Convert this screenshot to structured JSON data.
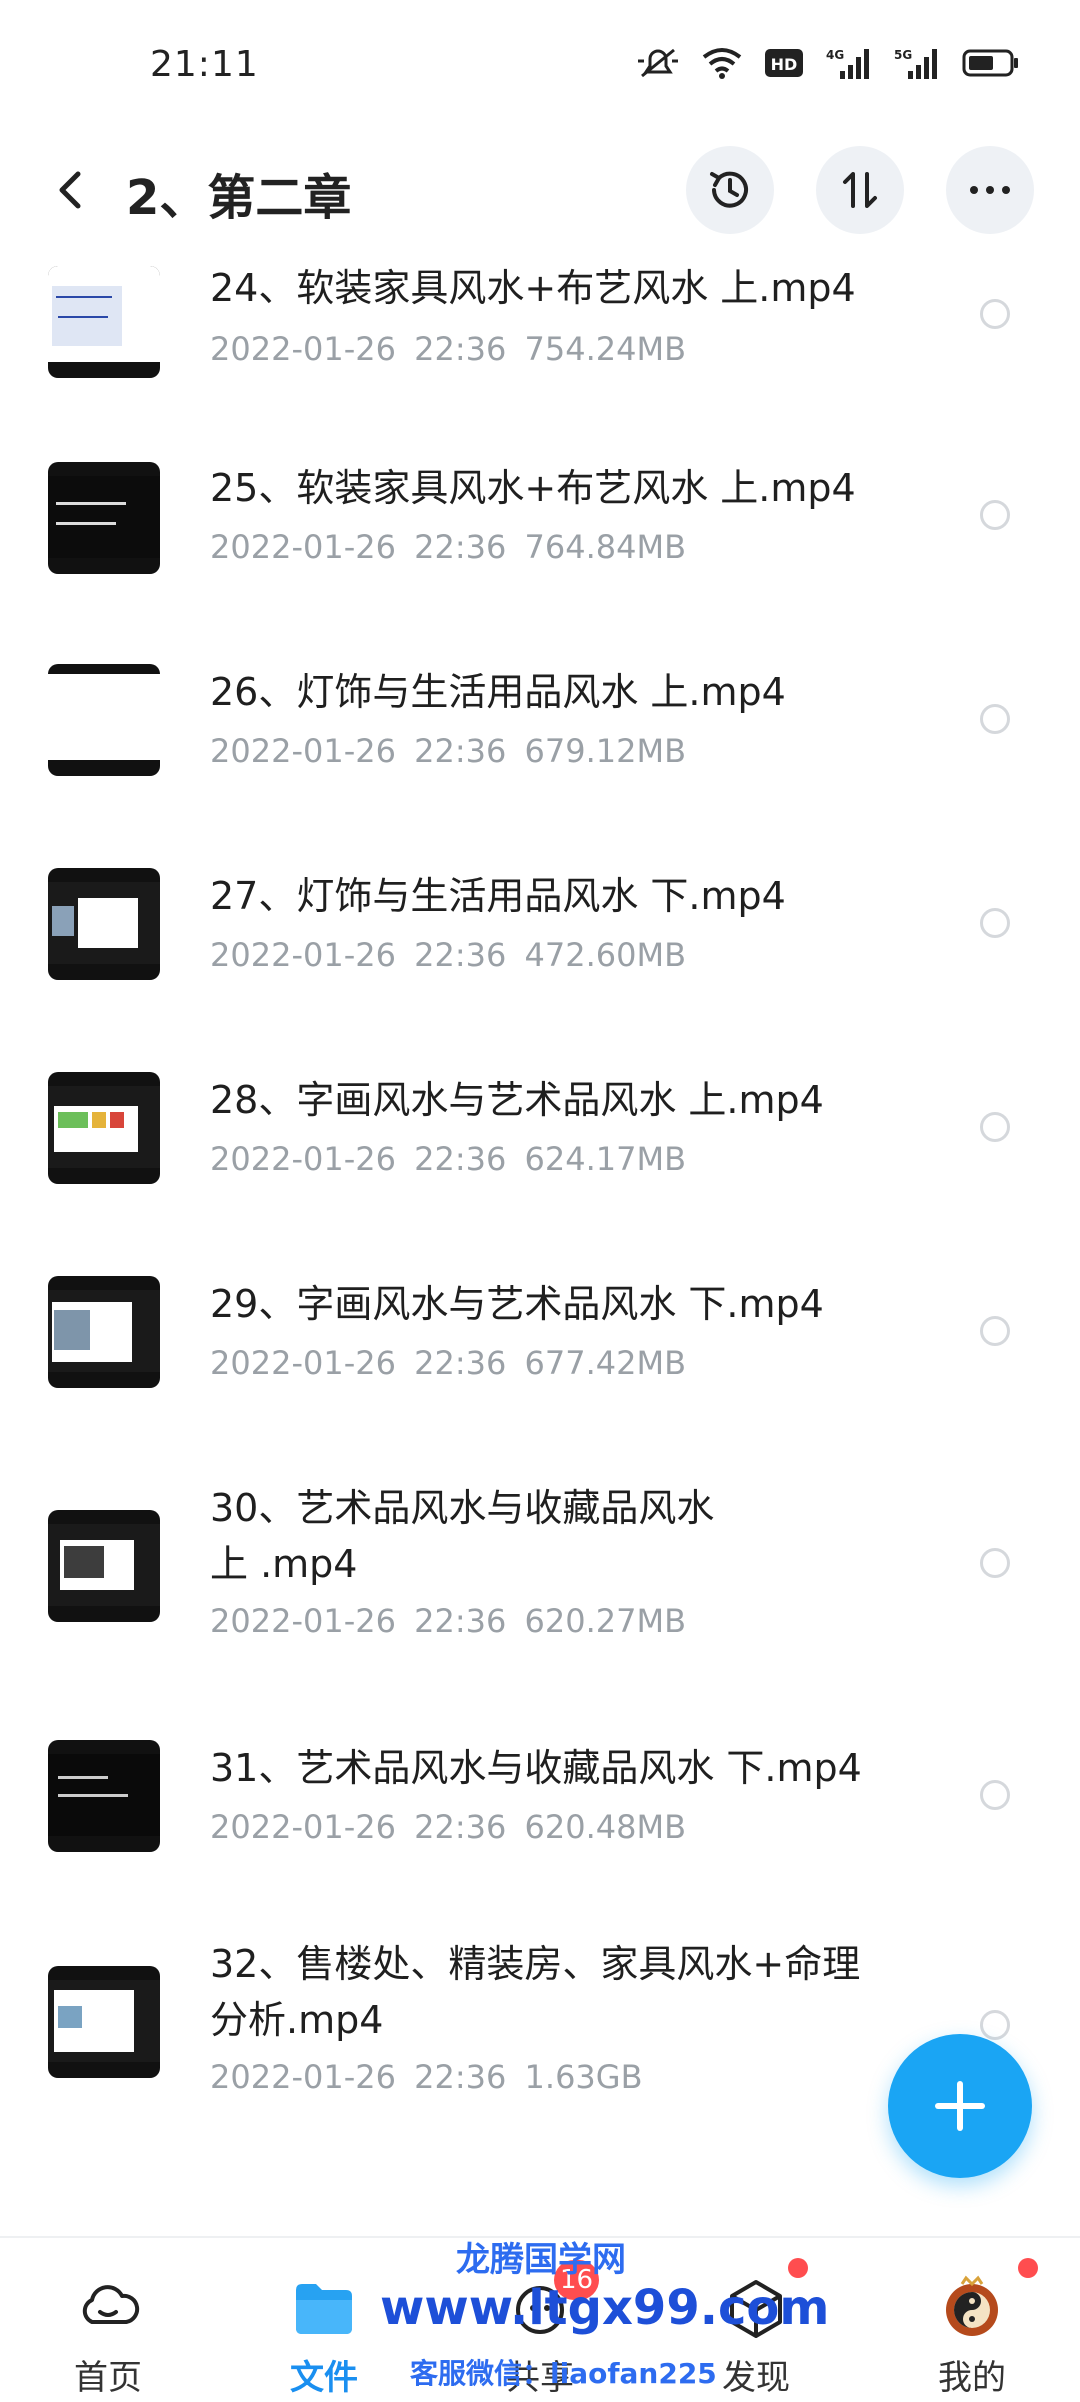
{
  "status_bar": {
    "time": "21:11"
  },
  "header": {
    "title": "2、第二章"
  },
  "files": [
    {
      "name": "24、软装家具风水+布艺风水 上.mp4",
      "date": "2022-01-26  22:36",
      "size": "754.24MB"
    },
    {
      "name": "25、软装家具风水+布艺风水 上.mp4",
      "date": "2022-01-26  22:36",
      "size": "764.84MB"
    },
    {
      "name": "26、灯饰与生活用品风水 上.mp4",
      "date": "2022-01-26  22:36",
      "size": "679.12MB"
    },
    {
      "name": "27、灯饰与生活用品风水 下.mp4",
      "date": "2022-01-26  22:36",
      "size": "472.60MB"
    },
    {
      "name": "28、字画风水与艺术品风水 上.mp4",
      "date": "2022-01-26  22:36",
      "size": "624.17MB"
    },
    {
      "name": "29、字画风水与艺术品风水 下.mp4",
      "date": "2022-01-26  22:36",
      "size": "677.42MB"
    },
    {
      "name": "30、艺术品风水与收藏品风水\n上 .mp4",
      "date": "2022-01-26  22:36",
      "size": "620.27MB"
    },
    {
      "name": "31、艺术品风水与收藏品风水 下.mp4",
      "date": "2022-01-26  22:36",
      "size": "620.48MB"
    },
    {
      "name": "32、售楼处、精装房、家具风水+命理\n分析.mp4",
      "date": "2022-01-26  22:36",
      "size": "1.63GB"
    }
  ],
  "bottom_nav": [
    {
      "label": "首页",
      "icon": "cloud-icon"
    },
    {
      "label": "文件",
      "icon": "folder-icon"
    },
    {
      "label": "共享",
      "icon": "share-icon",
      "badge": "16"
    },
    {
      "label": "发现",
      "icon": "discover-icon"
    },
    {
      "label": "我的",
      "icon": "avatar-icon"
    }
  ],
  "watermark": {
    "title": "龙腾国学网",
    "url": "www.ltgx99.com",
    "contact": "客服微信：liaofan225"
  },
  "colors": {
    "accent": "#1a8ff0",
    "fab": "#1aa5f4",
    "badge": "#ff4d4f"
  }
}
